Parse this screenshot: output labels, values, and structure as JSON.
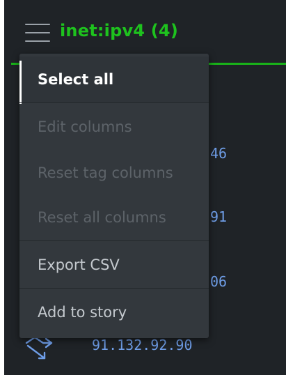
{
  "header": {
    "menu_icon": "hamburger-menu-icon",
    "title": "inet:ipv4 (4)"
  },
  "rows": {
    "partial_values": [
      "46",
      "91",
      "06"
    ],
    "last_ip": "91.132.92.90",
    "row_icon": "connection-icon"
  },
  "menu": {
    "items": [
      {
        "label": "Select all",
        "state": "active"
      },
      {
        "label": "Edit columns",
        "state": "disabled"
      },
      {
        "label": "Reset tag columns",
        "state": "disabled"
      },
      {
        "label": "Reset all columns",
        "state": "disabled"
      },
      {
        "label": "Export CSV",
        "state": "enabled"
      },
      {
        "label": "Add to story",
        "state": "enabled"
      }
    ]
  },
  "colors": {
    "title_green": "#1ec21e",
    "ip_blue": "#6f9ee8",
    "background": "#1f2327",
    "menu_background": "#33383d"
  }
}
